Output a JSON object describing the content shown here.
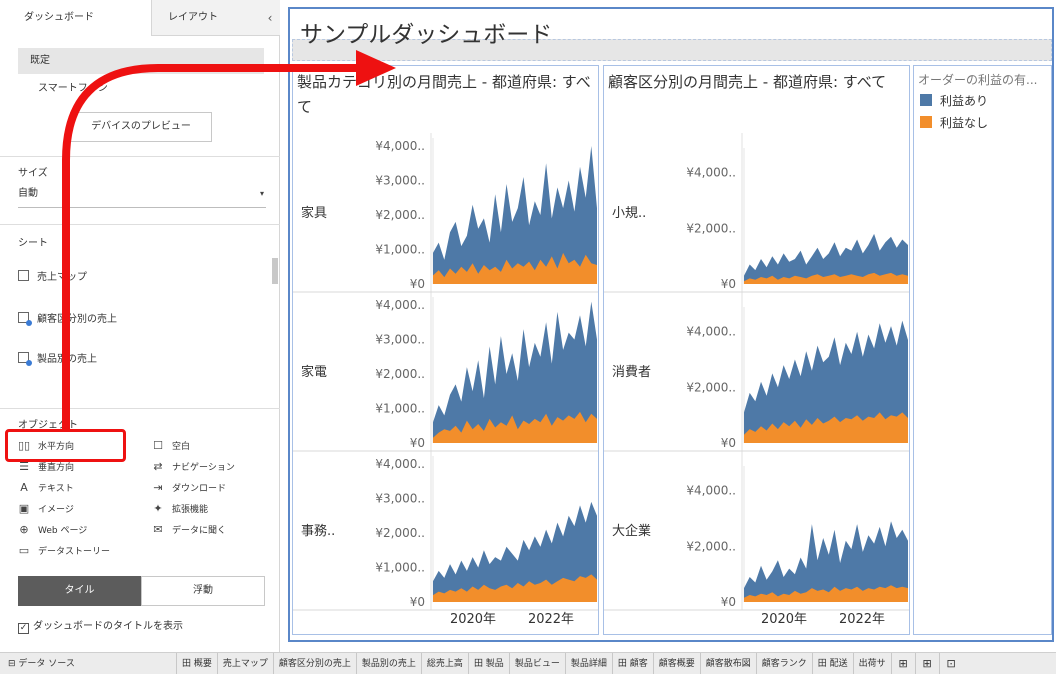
{
  "left_panel": {
    "tabs": {
      "dashboard": "ダッシュボード",
      "layout": "レイアウト",
      "collapse": "‹"
    },
    "devices": {
      "default": "既定",
      "phone": "スマートフォン"
    },
    "preview_button": "デバイスのプレビュー",
    "size": {
      "title": "サイズ",
      "value": "自動"
    },
    "sheets": {
      "title": "シート",
      "items": [
        "売上マップ",
        "顧客区分別の売上",
        "製品別の売上"
      ]
    },
    "objects": {
      "title": "オブジェクト",
      "items": [
        {
          "label": "水平方向",
          "icon": "▯▯"
        },
        {
          "label": "空白",
          "icon": "☐"
        },
        {
          "label": "垂直方向",
          "icon": "☰"
        },
        {
          "label": "ナビゲーション",
          "icon": "⇄"
        },
        {
          "label": "テキスト",
          "icon": "A"
        },
        {
          "label": "ダウンロード",
          "icon": "⇥"
        },
        {
          "label": "イメージ",
          "icon": "▣"
        },
        {
          "label": "拡張機能",
          "icon": "✦"
        },
        {
          "label": "Web ページ",
          "icon": "⊕"
        },
        {
          "label": "データに聞く",
          "icon": "✉"
        },
        {
          "label": "データストーリー",
          "icon": "▭"
        }
      ]
    },
    "tile_button": "タイル",
    "float_button": "浮動",
    "show_title_label": "ダッシュボードのタイトルを表示"
  },
  "dashboard": {
    "title": "サンプルダッシュボード",
    "panel1_title": "製品カテゴリ別の月間売上 - 都道府県: すべて",
    "panel2_title": "顧客区分別の月間売上 - 都道府県: すべて",
    "legend": {
      "title": "オーダーの利益の有...",
      "items": [
        {
          "label": "利益あり",
          "color": "#4e79a7"
        },
        {
          "label": "利益なし",
          "color": "#f28e2b"
        }
      ]
    }
  },
  "chart_data": [
    {
      "type": "area",
      "title": "製品カテゴリ別の月間売上 - 都道府県: すべて",
      "rows": [
        "家具",
        "家電",
        "事務.."
      ],
      "yticks": [
        "¥4,000..",
        "¥3,000..",
        "¥2,000..",
        "¥1,000..",
        "¥0"
      ],
      "xticks": [
        "2020年",
        "2022年"
      ],
      "series_colors": {
        "利益あり": "#4e79a7",
        "利益なし": "#f28e2b"
      },
      "panes": [
        {
          "row": "家具",
          "profit": [
            900,
            1200,
            700,
            1500,
            1800,
            1100,
            1400,
            2300,
            1600,
            1900,
            1200,
            2600,
            1500,
            2900,
            1800,
            2200,
            3100,
            1700,
            2400,
            2000,
            3500,
            1900,
            2800,
            2200,
            3000,
            2100,
            3400,
            2500,
            4000,
            2200
          ],
          "loss": [
            250,
            400,
            200,
            450,
            300,
            500,
            350,
            600,
            300,
            550,
            400,
            500,
            350,
            700,
            450,
            600,
            500,
            650,
            400,
            700,
            500,
            800,
            450,
            900,
            600,
            700,
            500,
            850,
            600,
            550
          ]
        },
        {
          "row": "家電",
          "profit": [
            600,
            1100,
            800,
            1400,
            1700,
            1200,
            2200,
            1500,
            2400,
            1300,
            2800,
            1700,
            3100,
            2000,
            2600,
            1800,
            3300,
            2200,
            2900,
            2500,
            3500,
            2300,
            3800,
            2700,
            3200,
            3000,
            3700,
            2800,
            4100,
            3000
          ],
          "loss": [
            150,
            300,
            400,
            350,
            500,
            300,
            650,
            400,
            550,
            350,
            700,
            450,
            600,
            500,
            800,
            400,
            650,
            550,
            700,
            600,
            850,
            500,
            750,
            650,
            800,
            700,
            900,
            600,
            850,
            700
          ],
          "gap_at": 1
        },
        {
          "row": "事務..",
          "profit": [
            600,
            900,
            700,
            1100,
            800,
            1200,
            900,
            1300,
            1000,
            1500,
            1100,
            1300,
            1200,
            1600,
            1400,
            1200,
            1800,
            1500,
            1900,
            1600,
            2100,
            1700,
            2300,
            1900,
            2500,
            2200,
            2800,
            2300,
            2900,
            2500
          ],
          "loss": [
            200,
            300,
            250,
            350,
            300,
            400,
            300,
            450,
            350,
            500,
            400,
            350,
            450,
            500,
            400,
            550,
            450,
            600,
            500,
            550,
            650,
            500,
            600,
            700,
            650,
            600,
            750,
            700,
            800,
            650
          ]
        }
      ]
    },
    {
      "type": "area",
      "title": "顧客区分別の月間売上 - 都道府県: すべて",
      "rows": [
        "小規..",
        "消費者",
        "大企業"
      ],
      "yticks": [
        "¥4,000..",
        "¥2,000..",
        "¥0"
      ],
      "xticks": [
        "2020年",
        "2022年"
      ],
      "series_colors": {
        "利益あり": "#4e79a7",
        "利益なし": "#f28e2b"
      },
      "panes": [
        {
          "row": "小規..",
          "profit": [
            300,
            700,
            500,
            900,
            600,
            1000,
            700,
            1100,
            800,
            900,
            1200,
            700,
            1000,
            1300,
            900,
            1100,
            1500,
            1000,
            1300,
            1200,
            1600,
            1100,
            1400,
            1800,
            1200,
            1500,
            1700,
            1300,
            1600,
            1400
          ],
          "loss": [
            100,
            200,
            150,
            250,
            200,
            300,
            150,
            250,
            200,
            300,
            250,
            200,
            300,
            350,
            250,
            300,
            350,
            250,
            300,
            350,
            300,
            250,
            350,
            400,
            300,
            350,
            400,
            300,
            350,
            300
          ]
        },
        {
          "row": "消費者",
          "profit": [
            1100,
            1800,
            1500,
            2200,
            1700,
            2500,
            2000,
            2800,
            2300,
            3000,
            2400,
            3300,
            2600,
            3500,
            2900,
            3100,
            3800,
            2800,
            3600,
            3200,
            4000,
            3100,
            3900,
            3400,
            4300,
            3600,
            4200,
            3500,
            4400,
            3700
          ],
          "loss": [
            300,
            500,
            400,
            600,
            450,
            700,
            500,
            750,
            600,
            800,
            550,
            850,
            650,
            900,
            700,
            800,
            950,
            750,
            900,
            850,
            1000,
            800,
            950,
            900,
            1100,
            850,
            1000,
            950,
            1100,
            900
          ]
        },
        {
          "row": "大企業",
          "profit": [
            500,
            900,
            700,
            1300,
            800,
            1100,
            1500,
            900,
            1200,
            1000,
            1600,
            1200,
            2800,
            1500,
            2300,
            1700,
            2600,
            1400,
            2200,
            1900,
            2800,
            1800,
            2400,
            2100,
            2700,
            2000,
            2900,
            2300,
            2600,
            2200
          ],
          "loss": [
            150,
            250,
            200,
            300,
            250,
            350,
            200,
            300,
            250,
            400,
            300,
            350,
            500,
            400,
            450,
            350,
            550,
            400,
            500,
            450,
            550,
            400,
            500,
            450,
            550,
            500,
            600,
            500,
            550,
            500
          ]
        }
      ]
    }
  ],
  "bottom_bar": {
    "datasource": "データ ソース",
    "tabs": [
      "田 概要",
      "売上マップ",
      "顧客区分別の売上",
      "製品別の売上",
      "総売上高",
      "田 製品",
      "製品ビュー",
      "製品詳細",
      "田 顧客",
      "顧客概要",
      "顧客散布図",
      "顧客ランク",
      "田 配送",
      "出荷サ"
    ],
    "icons": [
      "new-sheet",
      "new-dashboard",
      "new-story"
    ]
  }
}
